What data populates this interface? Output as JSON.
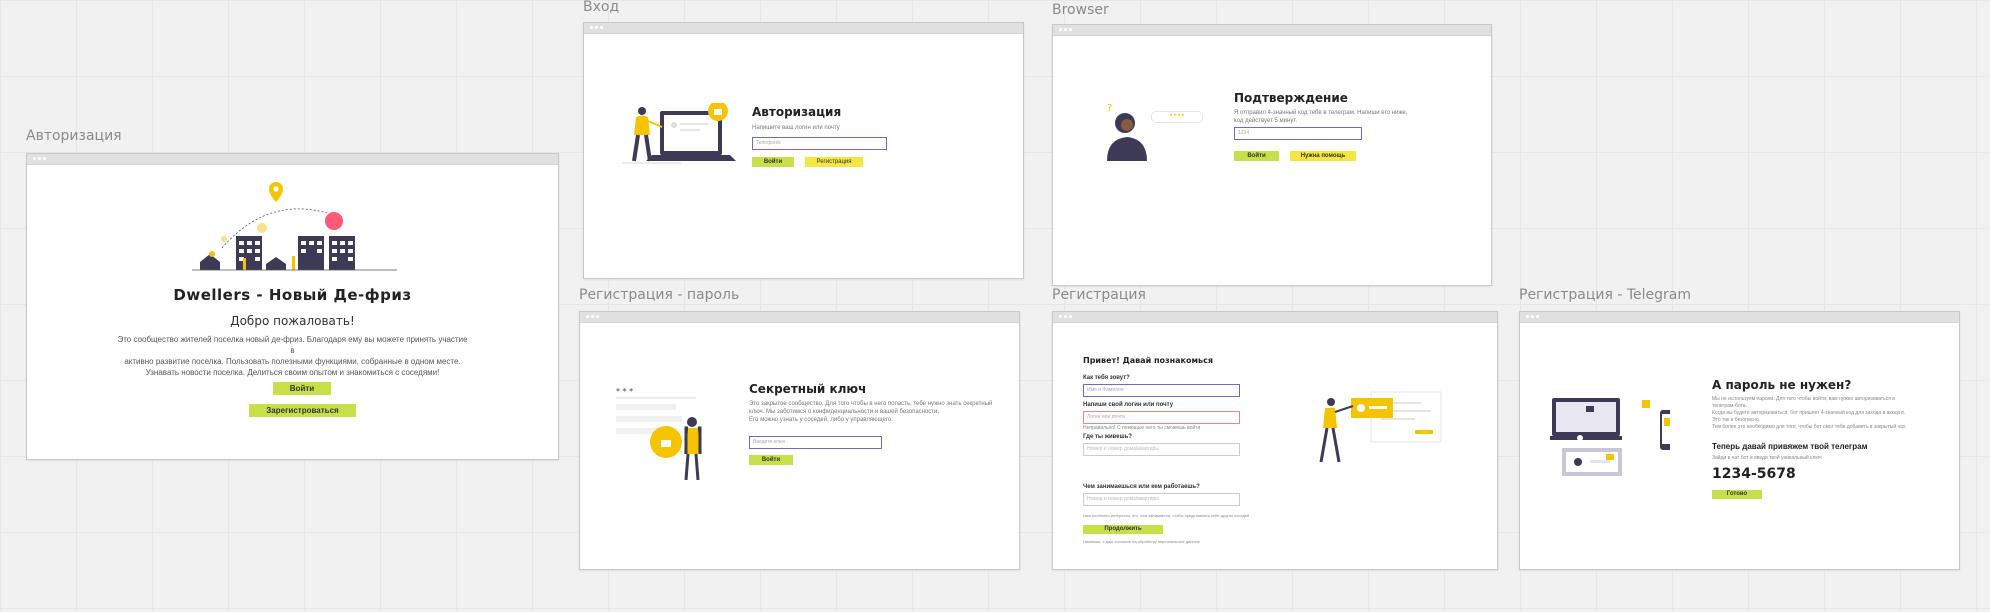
{
  "frames": {
    "auth": {
      "label": "Авторизация",
      "title": "Dwellers - Новый Де-фриз",
      "welcome": "Добро пожаловать!",
      "desc1": "Это сообщество жителей поселка новый де-фриз. Благодаря ему вы можете принять участие в",
      "desc2": "активно развитие поселка. Пользовать полезными функциями, собранные в одном месте.",
      "desc3": "Узнавать новости поселка. Делиться своим опытом и знакомиться с соседями!",
      "login_btn": "Войти",
      "register_btn": "Зарегистроваться"
    },
    "login": {
      "label": "Вход",
      "title": "Авторизация",
      "hint": "Напишите ваш логин или почту",
      "placeholder": "Телефон/е",
      "login_btn": "Войти",
      "register_btn": "Регистрация"
    },
    "browser": {
      "label": "Browser",
      "title": "Подтверждение",
      "hint1": "Я отправил 4-значный код тебе в телеграм. Напиши его ниже,",
      "hint2": "код действует 5 минут.",
      "placeholder": "1234",
      "login_btn": "Войти",
      "help_btn": "Нужна помощь",
      "stars": "* * * *"
    },
    "reg_password": {
      "label": "Регистрация - пароль",
      "title": "Секретный ключ",
      "hint1": "Это закрытое сообщество. Для того чтобы в него попасть, тебе нужно знать секретный",
      "hint2": "ключ. Мы заботимся о конфиденциальности и вашей безопасности.",
      "hint3": "Его можно узнать у соседей, либо у управляющего.",
      "placeholder": "Введите ключ",
      "login_btn": "Войти"
    },
    "registration": {
      "label": "Регистрация",
      "title": "Привет! Давай познакомься",
      "q_name": "Как тебя зовут?",
      "name_placeholder": "Имя и Фамилия",
      "q_login": "Напиши свой логин или почту",
      "login_placeholder": "Логин или почта",
      "login_error": "Неправильно! С помощью него ты сможешь войти",
      "q_house": "Где ты живешь?",
      "house_placeholder": "Номер и номер дома/квартиры",
      "q_work": "Чем занимаешься или кем работаешь?",
      "work_placeholder": "Номер и номер дома/квартиры",
      "work_hint": "Нам особенно интересно, кто, чем занимается, чтобы представлять себе других соседей",
      "continue_btn": "Продолжить",
      "consent": "Нажимая, я даю согласие на обработку персональных данных"
    },
    "reg_telegram": {
      "label": "Регистрация - Telegram",
      "title": "А пароль не нужен?",
      "p1": "Мы не используем пароли. Для того чтобы войти, вам нужно авторизоваться в",
      "p2": "телеграм-бота.",
      "p3": "Когда вы будете авторизоваться, бот пришлет 4-значный код для захода в аккаунт.",
      "p4": "Это так и безопасно.",
      "p5": "Тем более это необходимо для того, чтобы бот смог тебе добавить в закрытый чат.",
      "subtitle": "Теперь давай привяжем твой телеграм",
      "code_hint": "Зайди в чат бот и введи твой уникальный ключ",
      "code": "1234-5678",
      "ready_btn": "Готово"
    }
  }
}
